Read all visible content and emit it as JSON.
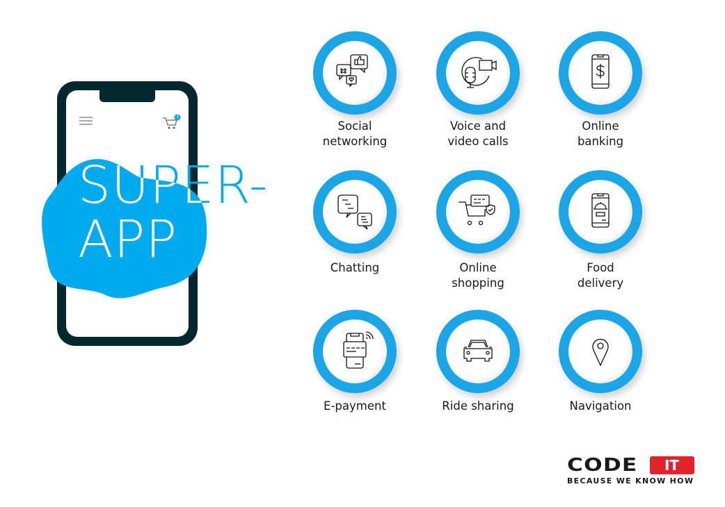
{
  "hero": {
    "line1": "SUPER-",
    "line2": "APP"
  },
  "phone": {
    "cart_badge_count": "1"
  },
  "features": [
    {
      "label_line1": "Social",
      "label_line2": "networking",
      "icon": "social-networking-icon"
    },
    {
      "label_line1": "Voice and",
      "label_line2": "video calls",
      "icon": "voice-video-call-icon"
    },
    {
      "label_line1": "Online",
      "label_line2": "banking",
      "icon": "mobile-banking-icon"
    },
    {
      "label_line1": "Chatting",
      "label_line2": "",
      "icon": "chat-bubbles-icon"
    },
    {
      "label_line1": "Online",
      "label_line2": "shopping",
      "icon": "shopping-cart-icon"
    },
    {
      "label_line1": "Food",
      "label_line2": "delivery",
      "icon": "food-delivery-icon"
    },
    {
      "label_line1": "E-payment",
      "label_line2": "",
      "icon": "payment-terminal-icon"
    },
    {
      "label_line1": "Ride sharing",
      "label_line2": "",
      "icon": "car-icon"
    },
    {
      "label_line1": "Navigation",
      "label_line2": "",
      "icon": "map-pin-icon"
    }
  ],
  "logo": {
    "brand": "CODE",
    "badge": "IT",
    "tagline": "BECAUSE WE KNOW HOW"
  },
  "colors": {
    "accent_blue": "#1aa5e6",
    "phone_dark": "#03282f",
    "logo_red": "#e3232a"
  }
}
